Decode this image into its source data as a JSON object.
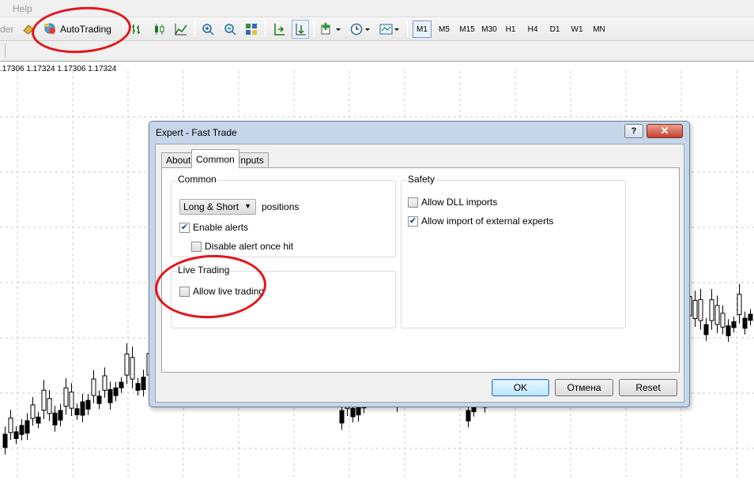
{
  "menubar": {
    "help_label": "Help"
  },
  "toolbar": {
    "cut_text": "der",
    "autotrading_label": "AutoTrading",
    "timeframes": [
      "M1",
      "M5",
      "M15",
      "M30",
      "H1",
      "H4",
      "D1",
      "W1",
      "MN"
    ],
    "active_timeframe": "M1"
  },
  "chart": {
    "ohlc_text": ".17306 1.17324 1.17306 1.17324"
  },
  "dialog": {
    "title": "Expert - Fast Trade",
    "help_label": "?",
    "close_label": "✕",
    "tabs": [
      "About",
      "Common",
      "Inputs"
    ],
    "active_tab": "Common",
    "common_group": {
      "title": "Common",
      "positions_select": "Long & Short",
      "positions_label": "positions",
      "enable_alerts": {
        "label": "Enable alerts",
        "checked": true
      },
      "disable_alert_once_hit": {
        "label": "Disable alert once hit",
        "checked": false
      }
    },
    "live_group": {
      "title": "Live Trading",
      "allow_live_trading": {
        "label": "Allow live trading",
        "checked": false
      }
    },
    "safety_group": {
      "title": "Safety",
      "allow_dll_imports": {
        "label": "Allow DLL imports",
        "checked": false
      },
      "allow_import_external_experts": {
        "label": "Allow import of external experts",
        "checked": true
      }
    },
    "buttons": {
      "ok": "OK",
      "cancel": "Отмена",
      "reset": "Reset"
    }
  },
  "colors": {
    "annotation_red": "#e3151c",
    "dialog_frame": "#c5d6ea"
  }
}
